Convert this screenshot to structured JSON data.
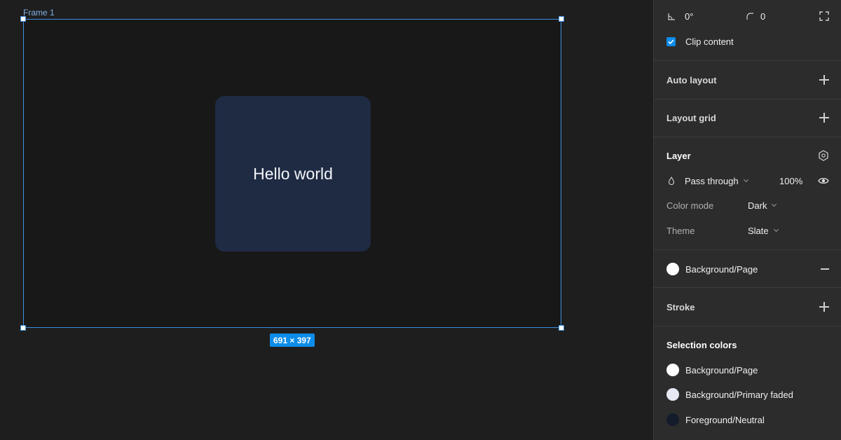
{
  "canvas": {
    "frame_label": "Frame 1",
    "card_text": "Hello world",
    "size_label": "691 × 397"
  },
  "panel": {
    "rotation": "0°",
    "corner_radius": "0",
    "clip_content_label": "Clip content",
    "clip_content_checked": true,
    "auto_layout_label": "Auto layout",
    "layout_grid_label": "Layout grid",
    "layer": {
      "title": "Layer",
      "blend_mode": "Pass through",
      "opacity": "100%",
      "color_mode_label": "Color mode",
      "color_mode_value": "Dark",
      "theme_label": "Theme",
      "theme_value": "Slate"
    },
    "fill": {
      "name": "Background/Page",
      "color": "#ffffff"
    },
    "stroke_label": "Stroke",
    "selection_colors": {
      "title": "Selection colors",
      "items": [
        {
          "name": "Background/Page",
          "color": "#ffffff"
        },
        {
          "name": "Background/Primary faded",
          "color": "#e6e8f4"
        },
        {
          "name": "Foreground/Neutral",
          "color": "#141b2b"
        }
      ]
    }
  },
  "colors": {
    "accent": "#0d8ce9",
    "card": "#1f2b43",
    "frame_bg": "#181818"
  }
}
